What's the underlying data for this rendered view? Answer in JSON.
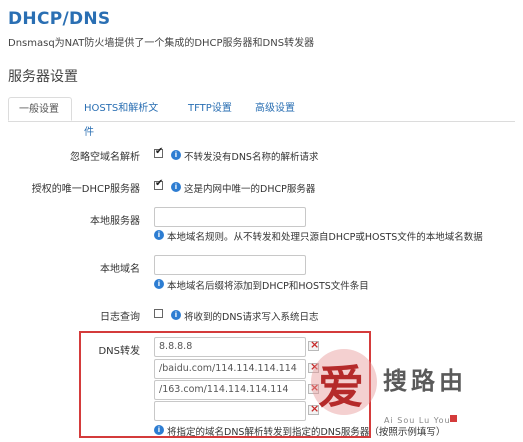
{
  "page": {
    "title": "DHCP/DNS",
    "description": "Dnsmasq为NAT防火墙提供了一个集成的DHCP服务器和DNS转发器",
    "section_title": "服务器设置"
  },
  "tabs": [
    {
      "label": "一般设置",
      "active": true
    },
    {
      "label": "HOSTS和解析文件",
      "active": false
    },
    {
      "label": "TFTP设置",
      "active": false
    },
    {
      "label": "高级设置",
      "active": false
    }
  ],
  "fields": {
    "domain_required": {
      "label": "忽略空域名解析",
      "checked": true,
      "hint": "不转发没有DNS名称的解析请求"
    },
    "authoritative": {
      "label": "授权的唯一DHCP服务器",
      "checked": true,
      "hint": "这是内网中唯一的DHCP服务器"
    },
    "local_server": {
      "label": "本地服务器",
      "value": "",
      "hint": "本地域名规则。从不转发和处理只源自DHCP或HOSTS文件的本地域名数据"
    },
    "local_domain": {
      "label": "本地域名",
      "value": "",
      "hint": "本地域名后缀将添加到DHCP和HOSTS文件条目"
    },
    "log_queries": {
      "label": "日志查询",
      "checked": false,
      "hint": "将收到的DNS请求写入系统日志"
    },
    "dns_forward": {
      "label": "DNS转发",
      "entries": [
        "8.8.8.8",
        "/baidu.com/114.114.114.114",
        "/163.com/114.114.114.114",
        ""
      ],
      "hint": "将指定的域名DNS解析转发到指定的DNS服务器（按照示例填写）"
    }
  },
  "watermark": {
    "glyph": "爱",
    "name": "搜路由",
    "sub": "Ai Sou Lu You"
  },
  "colors": {
    "title_blue": "#2a6fb3",
    "info_icon": "#2d7dd2",
    "highlight_border": "#d43b3b"
  }
}
